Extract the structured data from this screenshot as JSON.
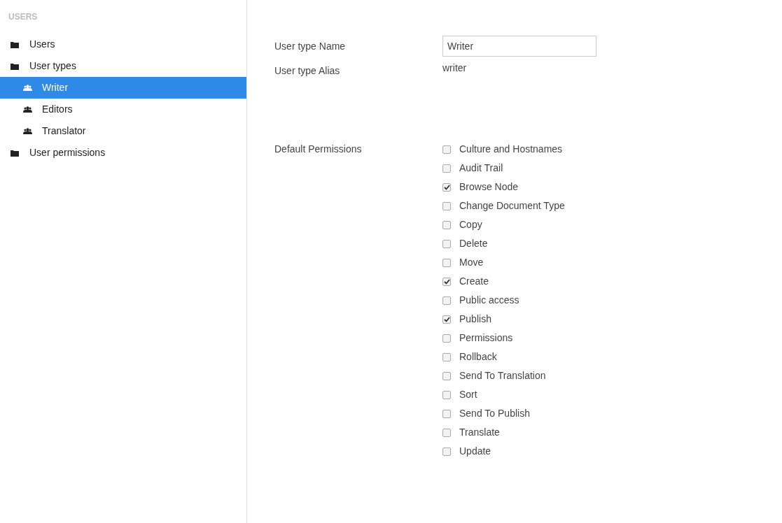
{
  "sidebar": {
    "heading": "USERS",
    "items": [
      {
        "label": "Users",
        "selected": false
      },
      {
        "label": "User types",
        "selected": false,
        "children": [
          {
            "label": "Writer",
            "selected": true
          },
          {
            "label": "Editors",
            "selected": false
          },
          {
            "label": "Translator",
            "selected": false
          }
        ]
      },
      {
        "label": "User permissions",
        "selected": false
      }
    ]
  },
  "form": {
    "name_label": "User type Name",
    "name_value": "Writer",
    "alias_label": "User type Alias",
    "alias_value": "writer",
    "permissions_label": "Default Permissions",
    "permissions": [
      {
        "label": "Culture and Hostnames",
        "checked": false
      },
      {
        "label": "Audit Trail",
        "checked": false
      },
      {
        "label": "Browse Node",
        "checked": true
      },
      {
        "label": "Change Document Type",
        "checked": false
      },
      {
        "label": "Copy",
        "checked": false
      },
      {
        "label": "Delete",
        "checked": false
      },
      {
        "label": "Move",
        "checked": false
      },
      {
        "label": "Create",
        "checked": true
      },
      {
        "label": "Public access",
        "checked": false
      },
      {
        "label": "Publish",
        "checked": true
      },
      {
        "label": "Permissions",
        "checked": false
      },
      {
        "label": "Rollback",
        "checked": false
      },
      {
        "label": "Send To Translation",
        "checked": false
      },
      {
        "label": "Sort",
        "checked": false
      },
      {
        "label": "Send To Publish",
        "checked": false
      },
      {
        "label": "Translate",
        "checked": false
      },
      {
        "label": "Update",
        "checked": false
      }
    ]
  }
}
